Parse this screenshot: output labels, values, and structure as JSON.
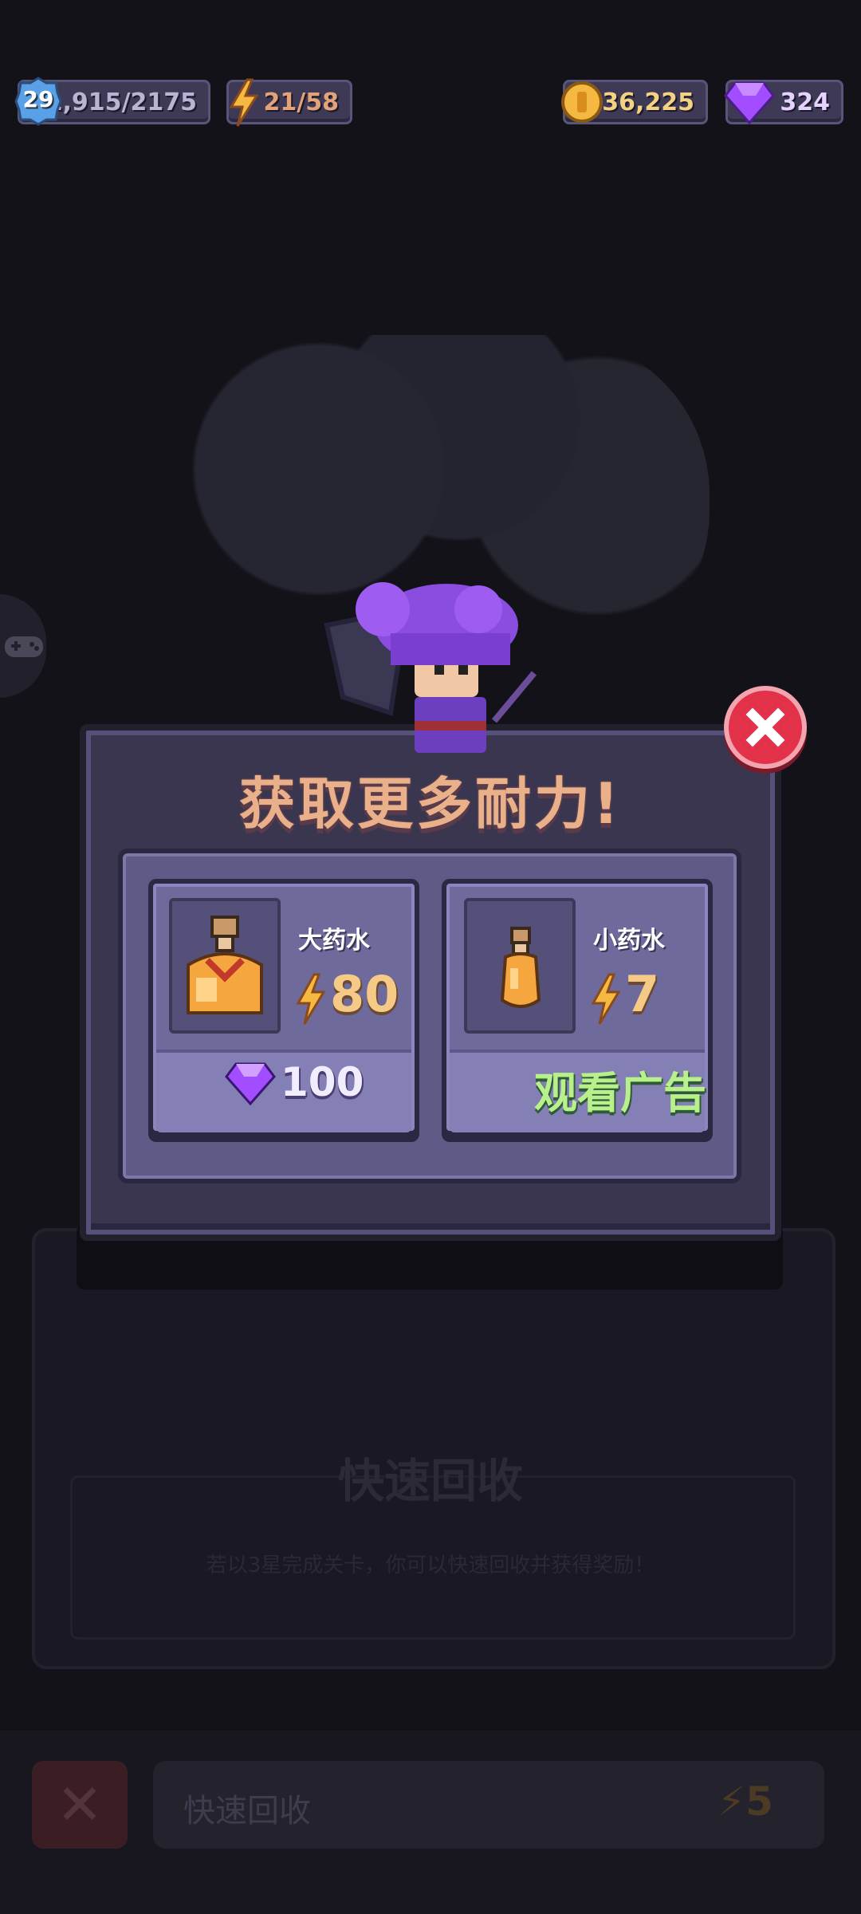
{
  "hud": {
    "level": "29",
    "xp": "1,915/2175",
    "energy": "21/58",
    "coins": "36,225",
    "gems": "324"
  },
  "modal": {
    "title": "获取更多耐力!",
    "items": [
      {
        "name": "大药水",
        "energy_amount": "80",
        "price": "100",
        "price_icon": "gem-icon"
      },
      {
        "name": "小药水",
        "energy_amount": "7",
        "action": "观看广告"
      }
    ]
  },
  "background": {
    "section_title": "快速回收",
    "section_description": "若以3星完成关卡，你可以快速回收并获得奖励！",
    "bottom_button_label": "快速回收",
    "bottom_button_cost": "5"
  },
  "colors": {
    "accent_orange": "#f5b942",
    "gem_purple": "#a24dff",
    "close_red": "#e2324a",
    "ad_green": "#b8f08b"
  }
}
